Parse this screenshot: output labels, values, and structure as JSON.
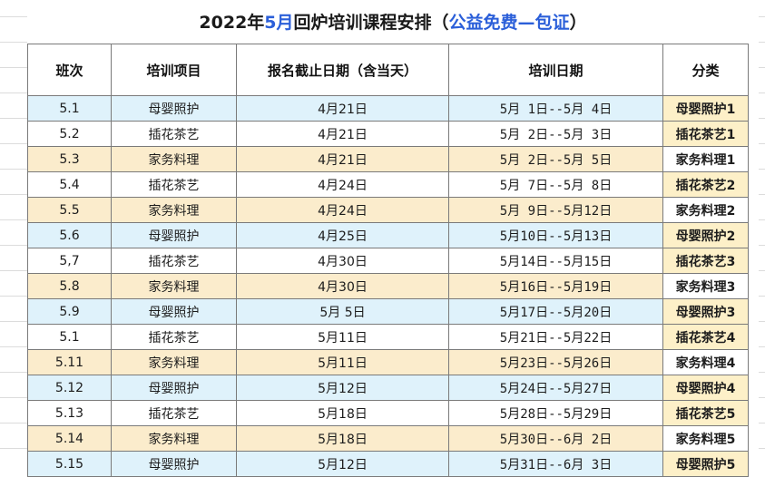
{
  "title": {
    "part1": "2022年",
    "part2": "5月",
    "part3": "回炉培训课程安排（",
    "part4": "公益免费—包证",
    "part5": "）"
  },
  "headers": [
    "班次",
    "培训项目",
    "报名截止日期（含当天）",
    "培训日期",
    "分类"
  ],
  "colors": {
    "blue_row": "#dff2fb",
    "tan_row": "#fbeccc",
    "white_row": "#ffffff",
    "title_highlight": "#2b5fd9"
  },
  "rows": [
    {
      "class": "5.1",
      "project": "母婴照护",
      "deadline": "4月21日",
      "dates": "5月 1日--5月 4日",
      "category": "母婴照护1"
    },
    {
      "class": "5.2",
      "project": "插花茶艺",
      "deadline": "4月21日",
      "dates": "5月 2日--5月 3日",
      "category": "插花茶艺1"
    },
    {
      "class": "5.3",
      "project": "家务料理",
      "deadline": "4月21日",
      "dates": "5月 2日--5月 5日",
      "category": "家务料理1"
    },
    {
      "class": "5.4",
      "project": "插花茶艺",
      "deadline": "4月24日",
      "dates": "5月 7日--5月 8日",
      "category": "插花茶艺2"
    },
    {
      "class": "5.5",
      "project": "家务料理",
      "deadline": "4月24日",
      "dates": "5月 9日--5月12日",
      "category": "家务料理2"
    },
    {
      "class": "5.6",
      "project": "母婴照护",
      "deadline": "4月25日",
      "dates": "5月10日--5月13日",
      "category": "母婴照护2"
    },
    {
      "class": "5,7",
      "project": "插花茶艺",
      "deadline": "4月30日",
      "dates": "5月14日--5月15日",
      "category": "插花茶艺3"
    },
    {
      "class": "5.8",
      "project": "家务料理",
      "deadline": "4月30日",
      "dates": "5月16日--5月19日",
      "category": "家务料理3"
    },
    {
      "class": "5.9",
      "project": "母婴照护",
      "deadline": "5月 5日",
      "dates": "5月17日--5月20日",
      "category": "母婴照护3"
    },
    {
      "class": "5.1",
      "project": "插花茶艺",
      "deadline": "5月11日",
      "dates": "5月21日--5月22日",
      "category": "插花茶艺4"
    },
    {
      "class": "5.11",
      "project": "家务料理",
      "deadline": "5月11日",
      "dates": "5月23日--5月26日",
      "category": "家务料理4"
    },
    {
      "class": "5.12",
      "project": "母婴照护",
      "deadline": "5月12日",
      "dates": "5月24日--5月27日",
      "category": "母婴照护4"
    },
    {
      "class": "5.13",
      "project": "插花茶艺",
      "deadline": "5月18日",
      "dates": "5月28日--5月29日",
      "category": "插花茶艺5"
    },
    {
      "class": "5.14",
      "project": "家务料理",
      "deadline": "5月18日",
      "dates": "5月30日--6月 2日",
      "category": "家务料理5"
    },
    {
      "class": "5.15",
      "project": "母婴照护",
      "deadline": "5月12日",
      "dates": "5月31日--6月 3日",
      "category": "母婴照护5"
    }
  ]
}
